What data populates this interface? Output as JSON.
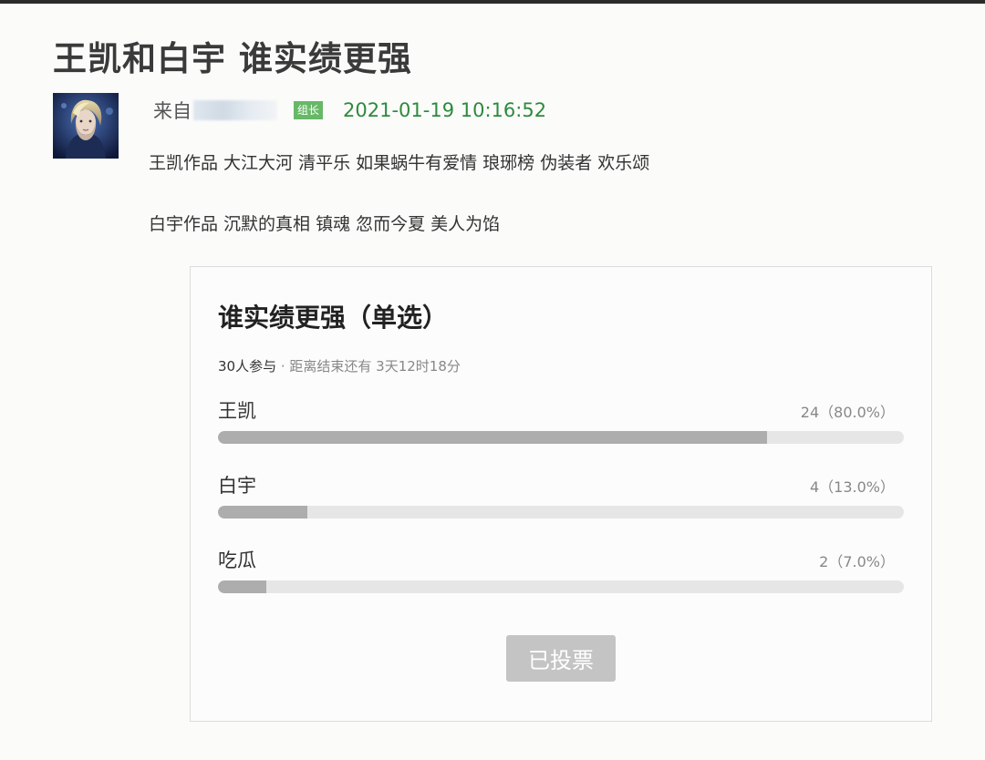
{
  "post": {
    "title": "王凯和白宇 谁实绩更强",
    "author_prefix": "来自",
    "badge": "组长",
    "datetime": "2021-01-19 10:16:52",
    "lines": [
      "王凯作品 大江大河 清平乐 如果蜗牛有爱情 琅琊榜 伪装者 欢乐颂",
      "白宇作品 沉默的真相 镇魂 忽而今夏 美人为馅"
    ]
  },
  "poll": {
    "title": "谁实绩更强（单选）",
    "participants": "30人参与",
    "remaining": "· 距离结束还有 3天12时18分",
    "options": [
      {
        "label": "王凯",
        "result": "24（80.0%）",
        "fraction": 0.8
      },
      {
        "label": "白宇",
        "result": "4（13.0%）",
        "fraction": 0.13
      },
      {
        "label": "吃瓜",
        "result": "2（7.0%）",
        "fraction": 0.07
      }
    ],
    "button_label": "已投票"
  },
  "colors": {
    "date_green": "#2d8a3d",
    "badge_green": "#67b867",
    "bar_fill": "#adadad",
    "bar_track": "#e6e6e6"
  },
  "icons": {
    "avatar": "user-avatar-image"
  }
}
